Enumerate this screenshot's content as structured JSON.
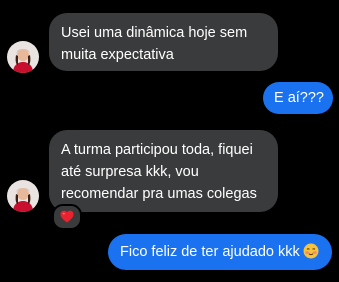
{
  "messages": [
    {
      "direction": "incoming",
      "lines": [
        "Usei uma dinâmica hoje sem",
        "muita expectativa"
      ]
    },
    {
      "direction": "outgoing",
      "lines": [
        "E aí???"
      ]
    },
    {
      "direction": "incoming",
      "lines": [
        "A turma participou toda, fiquei",
        "até surpresa kkk, vou",
        "recomendar pra umas colegas"
      ],
      "reaction": "heart-emoji"
    },
    {
      "direction": "outgoing",
      "lines": [
        "Fico feliz de ter ajudado kkk"
      ],
      "trailing_emoji": "blushing-face-emoji"
    }
  ],
  "colors": {
    "background": "#000000",
    "incoming_bubble": "#3a3b3c",
    "outgoing_bubble": "#1a72f0",
    "text": "#ffffff"
  }
}
